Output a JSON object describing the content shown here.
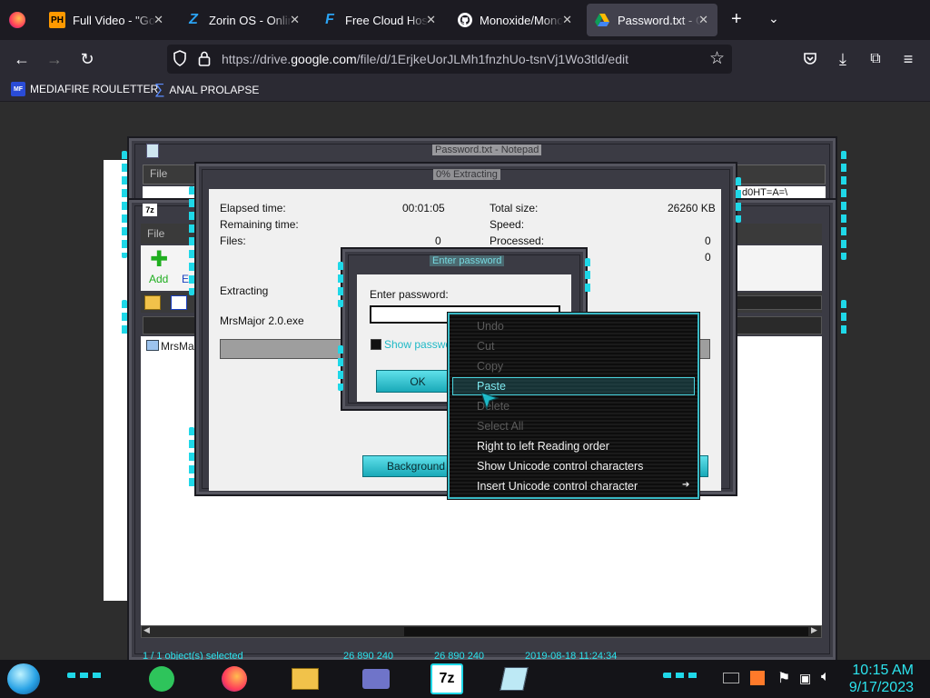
{
  "browser": {
    "tabs": [
      {
        "label": "Full Video - \"Go I",
        "favicon": "PH"
      },
      {
        "label": "Zorin OS - Online",
        "favicon": "Z"
      },
      {
        "label": "Free Cloud Hosti",
        "favicon": "F"
      },
      {
        "label": "Monoxide/Mono",
        "favicon": "github"
      },
      {
        "label": "Password.txt - Go",
        "favicon": "drive"
      }
    ],
    "new_tab_label": "+",
    "url_prefix": "https://drive.",
    "url_domain": "google.com",
    "url_suffix": "/file/d/1ErjkeUorJLMh1fnzhUo-tsnVj1Wo3tld/edit",
    "bookmarks": [
      {
        "label": "MEDIAFIRE ROULETTER",
        "icon": "MF"
      },
      {
        "label": "ANAL PROLAPSE",
        "icon": "sigma"
      }
    ]
  },
  "notepad": {
    "title": "Password.txt - Notepad",
    "menu_file": "File",
    "edit_snippet": "d0HT=A=\\"
  },
  "sevenzip": {
    "app_icon": "7z",
    "menu_file": "File",
    "toolbar_add": "Add",
    "toolbar_extract": "Ex",
    "file_item": "MrsMa",
    "status_selected": "1 / 1 object(s) selected",
    "status_size1": "26 890 240",
    "status_size2": "26 890 240",
    "status_date": "2019-08-18 11:24:34"
  },
  "progress": {
    "title": "0% Extracting",
    "elapsed_label": "Elapsed time:",
    "elapsed_value": "00:01:05",
    "remaining_label": "Remaining time:",
    "files_label": "Files:",
    "files_value": "0",
    "total_label": "Total size:",
    "total_value": "26260 KB",
    "speed_label": "Speed:",
    "processed_label": "Processed:",
    "processed_value": "0",
    "extra_value": "0",
    "extracting_label": "Extracting",
    "file_name": "MrsMajor 2.0.exe",
    "background_button": "Background"
  },
  "password_dialog": {
    "title": "Enter password",
    "prompt": "Enter password:",
    "input_value": "",
    "show_password": "Show password",
    "ok_button": "OK"
  },
  "context_menu": {
    "items": [
      {
        "label": "Undo",
        "enabled": false
      },
      {
        "label": "Cut",
        "enabled": false
      },
      {
        "label": "Copy",
        "enabled": false
      },
      {
        "label": "Paste",
        "enabled": true
      },
      {
        "label": "Delete",
        "enabled": false
      },
      {
        "label": "Select All",
        "enabled": false
      },
      {
        "label": "Right to left Reading order",
        "enabled": true
      },
      {
        "label": "Show Unicode control characters",
        "enabled": true
      },
      {
        "label": "Insert Unicode control character",
        "enabled": true
      }
    ],
    "highlighted": "Paste"
  },
  "taskbar": {
    "apps": [
      "sound-app",
      "firefox",
      "file-manager",
      "settings",
      "7z",
      "notepad"
    ],
    "app_7z_label": "7z",
    "clock_time": "10:15 AM",
    "clock_date": "9/17/2023"
  },
  "colors": {
    "accent": "#1fd8e8",
    "chrome_dark": "#1c1b22",
    "chrome": "#2b2a33"
  }
}
